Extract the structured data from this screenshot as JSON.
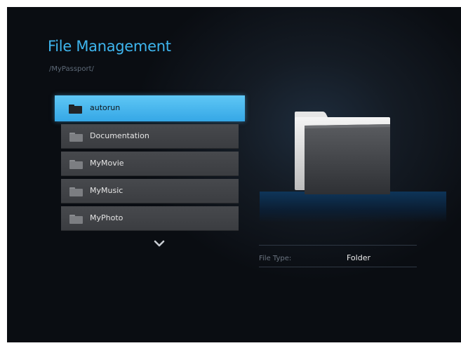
{
  "header": {
    "title": "File Management",
    "path": "/MyPassport/"
  },
  "file_list": {
    "items": [
      {
        "label": "autorun",
        "selected": true,
        "icon": "folder-icon"
      },
      {
        "label": "Documentation",
        "selected": false,
        "icon": "folder-icon"
      },
      {
        "label": "MyMovie",
        "selected": false,
        "icon": "folder-icon"
      },
      {
        "label": "MyMusic",
        "selected": false,
        "icon": "folder-icon"
      },
      {
        "label": "MyPhoto",
        "selected": false,
        "icon": "folder-icon"
      }
    ],
    "scroll_icon": "chevron-down-icon"
  },
  "details": {
    "preview_icon": "folder-preview-icon",
    "file_type_label": "File Type:",
    "file_type_value": "Folder"
  },
  "colors": {
    "accent": "#3eb5ee",
    "selected_row": "#4cb9f0",
    "row": "#414347",
    "background": "#0d1117"
  }
}
